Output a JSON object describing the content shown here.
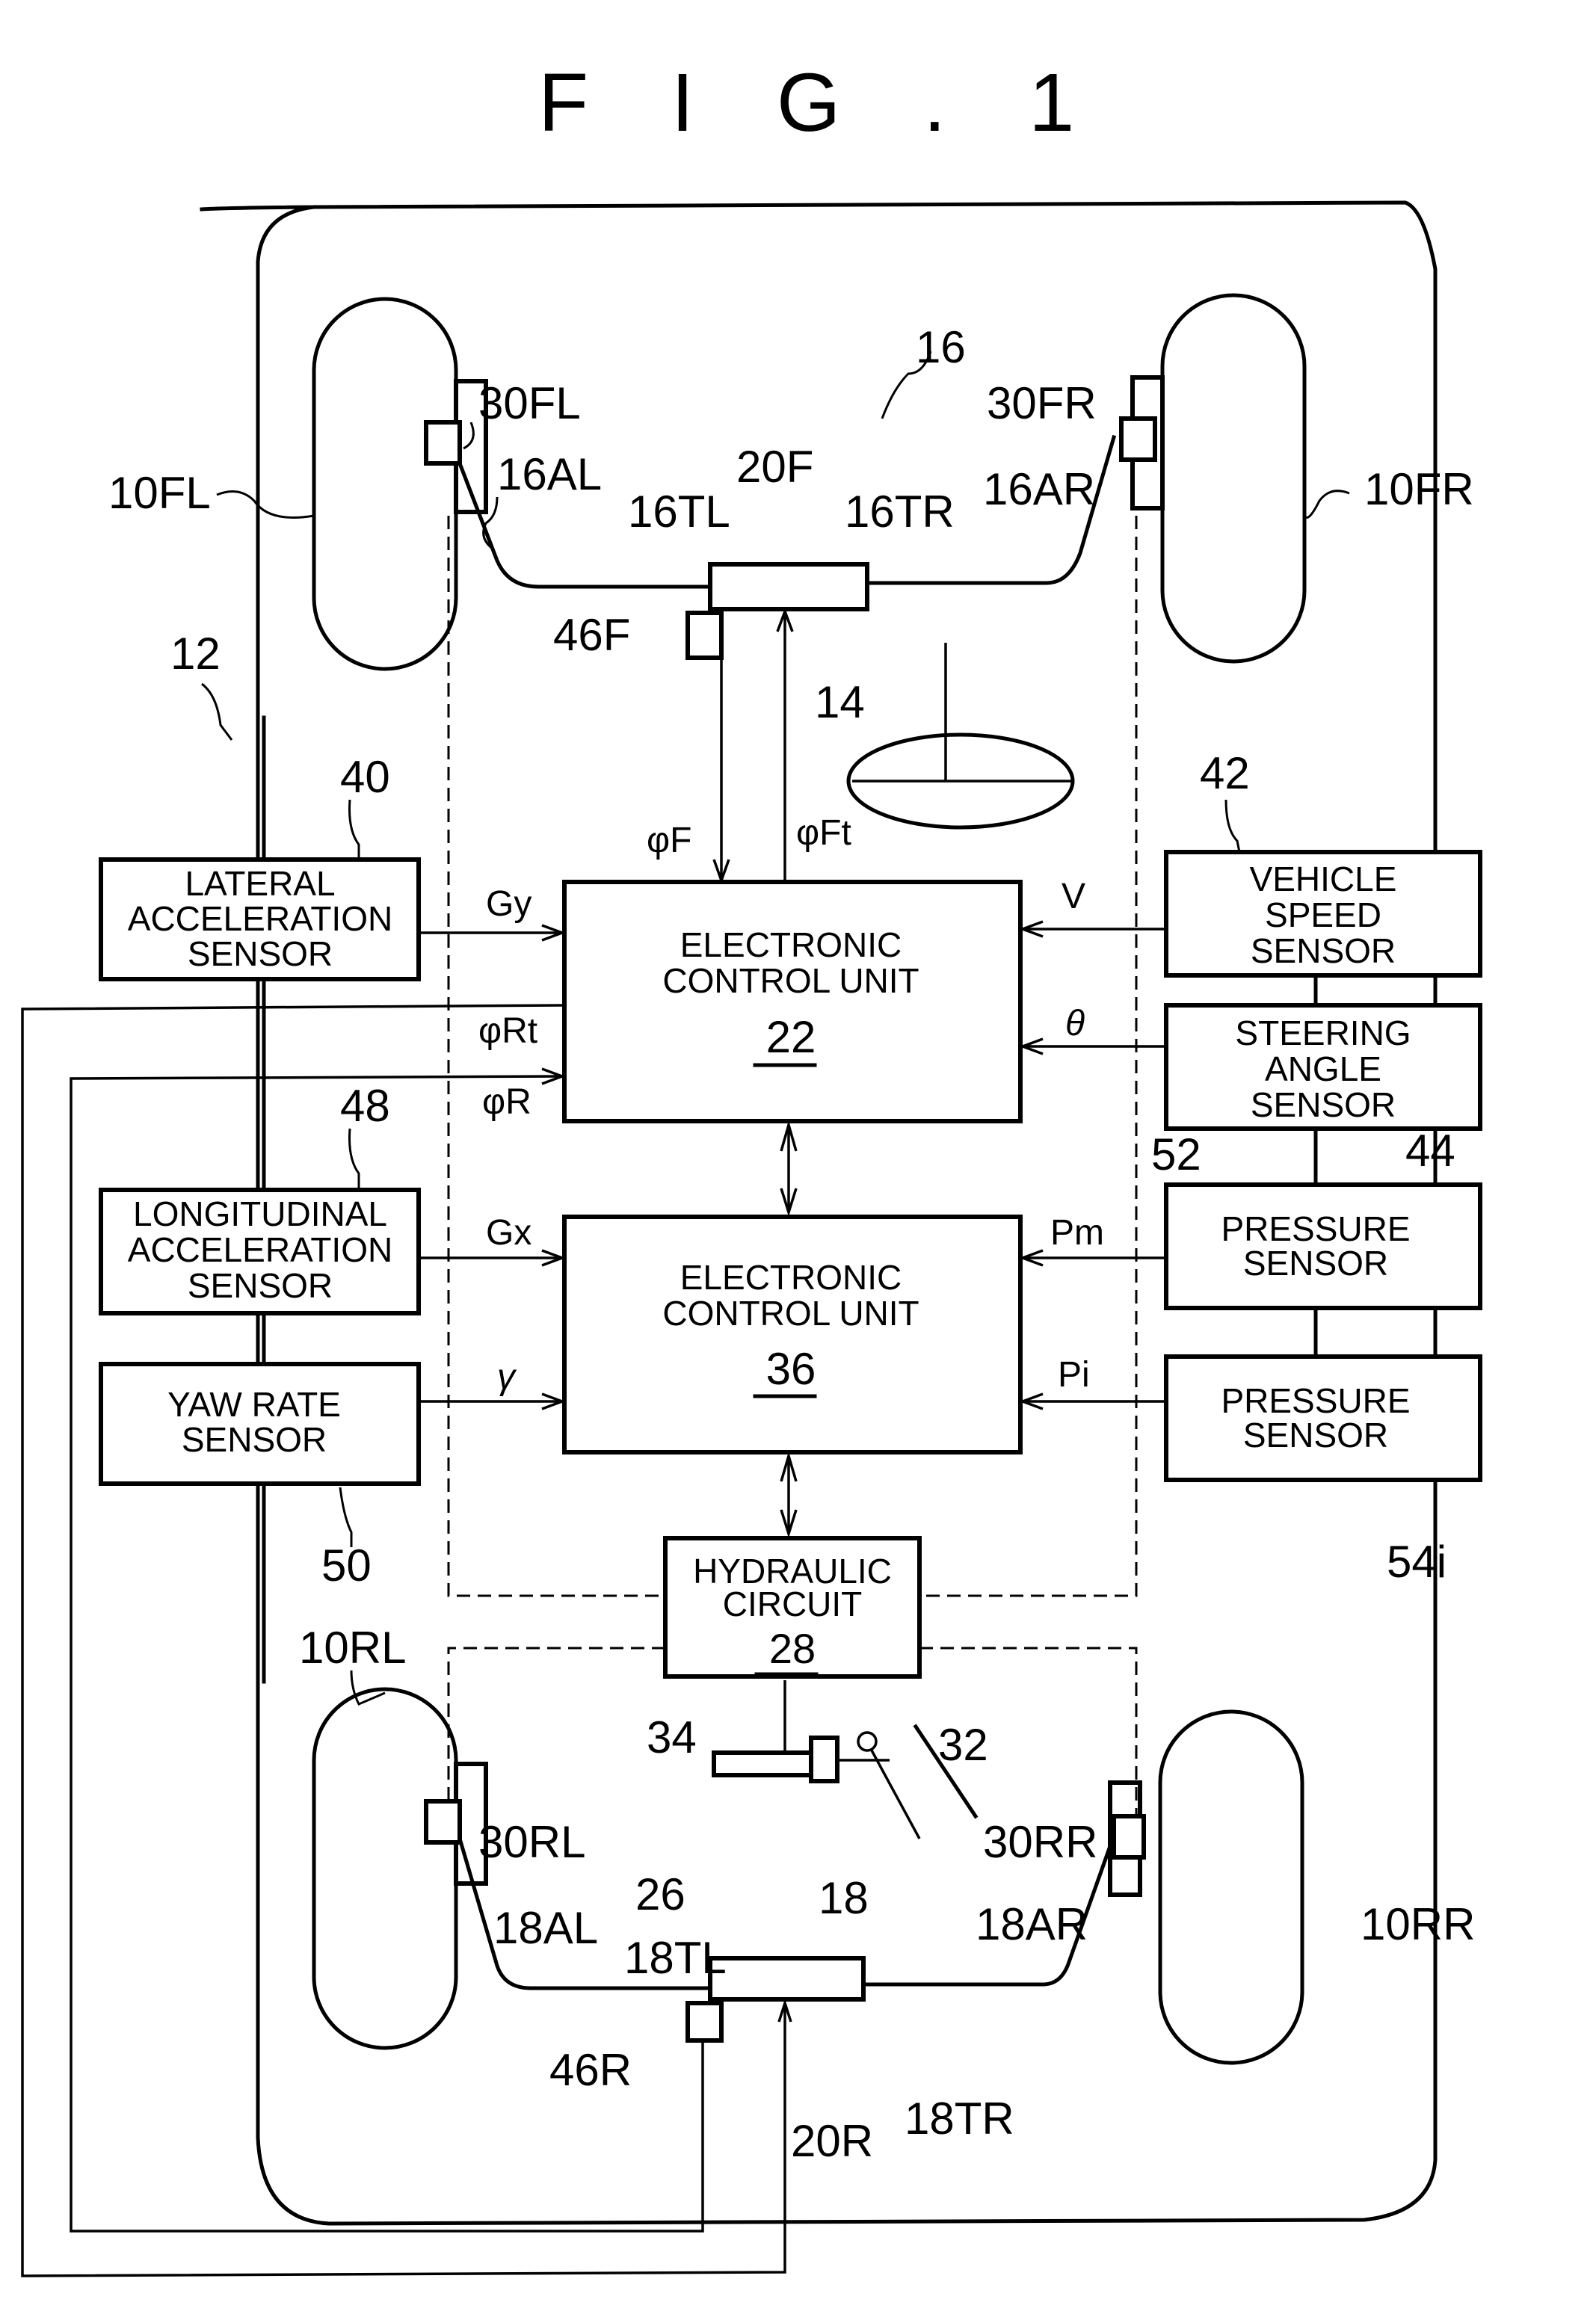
{
  "figure": {
    "title": "F I G . 1"
  },
  "colors": {
    "line": "#000000",
    "background": "#ffffff"
  },
  "blocks": {
    "lateral": {
      "lines": [
        "LATERAL",
        "ACCELERATION",
        "SENSOR"
      ],
      "ref": "40"
    },
    "longitudinal": {
      "lines": [
        "LONGITUDINAL",
        "ACCELERATION",
        "SENSOR"
      ],
      "ref": "48"
    },
    "yaw": {
      "lines": [
        "YAW RATE",
        "SENSOR"
      ],
      "ref": "50"
    },
    "speed": {
      "lines": [
        "VEHICLE",
        "SPEED",
        "SENSOR"
      ],
      "ref": "42"
    },
    "steering": {
      "lines": [
        "STEERING",
        "ANGLE",
        "SENSOR"
      ],
      "ref": "44"
    },
    "pressure_m": {
      "lines": [
        "PRESSURE",
        "SENSOR"
      ],
      "ref": "52"
    },
    "pressure_i": {
      "lines": [
        "PRESSURE",
        "SENSOR"
      ],
      "ref": "54i"
    },
    "ecu22": {
      "lines": [
        "ELECTRONIC",
        "CONTROL UNIT"
      ],
      "num": "22"
    },
    "ecu36": {
      "lines": [
        "ELECTRONIC",
        "CONTROL UNIT"
      ],
      "num": "36"
    },
    "hydraulic": {
      "lines": [
        "HYDRAULIC",
        "CIRCUIT"
      ],
      "num": "28"
    }
  },
  "signals": {
    "gy": "Gy",
    "gx": "Gx",
    "gamma": "γ",
    "v": "V",
    "theta": "θ",
    "pm": "Pm",
    "pi": "Pi",
    "phiF": "φF",
    "phiFt": "φFt",
    "phiRt": "φRt",
    "phiR": "φR"
  },
  "refs": {
    "r10FL": "10FL",
    "r10FR": "10FR",
    "r10RL": "10RL",
    "r10RR": "10RR",
    "r12": "12",
    "r14": "14",
    "r16": "16",
    "r16AL": "16AL",
    "r16AR": "16AR",
    "r16TL": "16TL",
    "r16TR": "16TR",
    "r20F": "20F",
    "r20R": "20R",
    "r30FL": "30FL",
    "r30FR": "30FR",
    "r30RL": "30RL",
    "r30RR": "30RR",
    "r46F": "46F",
    "r46R": "46R",
    "r18": "18",
    "r18AL": "18AL",
    "r18AR": "18AR",
    "r18TL": "18TL",
    "r18TR": "18TR",
    "r26": "26",
    "r32": "32",
    "r34": "34"
  }
}
